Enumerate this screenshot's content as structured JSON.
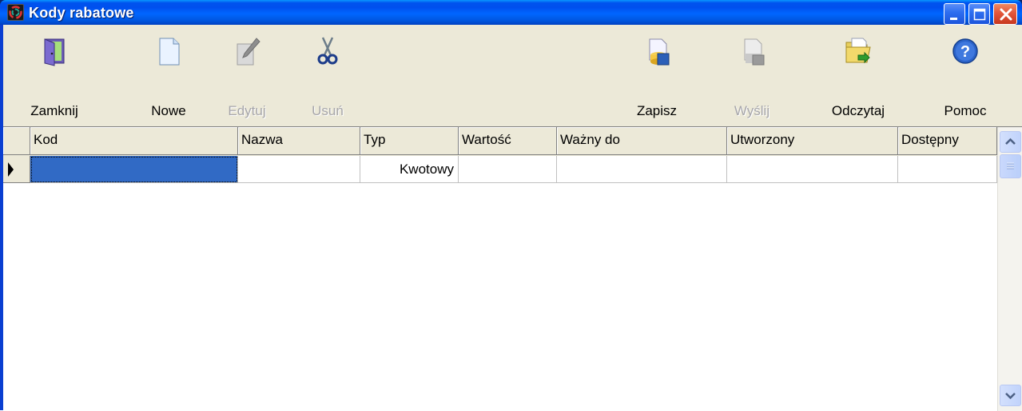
{
  "window": {
    "title": "Kody rabatowe"
  },
  "toolbar": {
    "zamknij": "Zamknij",
    "nowe": "Nowe",
    "edytuj": "Edytuj",
    "usun": "Usuń",
    "zapisz": "Zapisz",
    "wyslij": "Wyślij",
    "odczytaj": "Odczytaj",
    "pomoc": "Pomoc"
  },
  "grid": {
    "columns": [
      "Kod",
      "Nazwa",
      "Typ",
      "Wartość",
      "Ważny do",
      "Utworzony",
      "Dostępny"
    ],
    "rows": [
      [
        "",
        "",
        "Kwotowy",
        "",
        "",
        "",
        ""
      ]
    ]
  },
  "colors": {
    "titlebar": "#0055ea",
    "selection": "#316ac5",
    "toolbar_bg": "#ece9d8"
  }
}
